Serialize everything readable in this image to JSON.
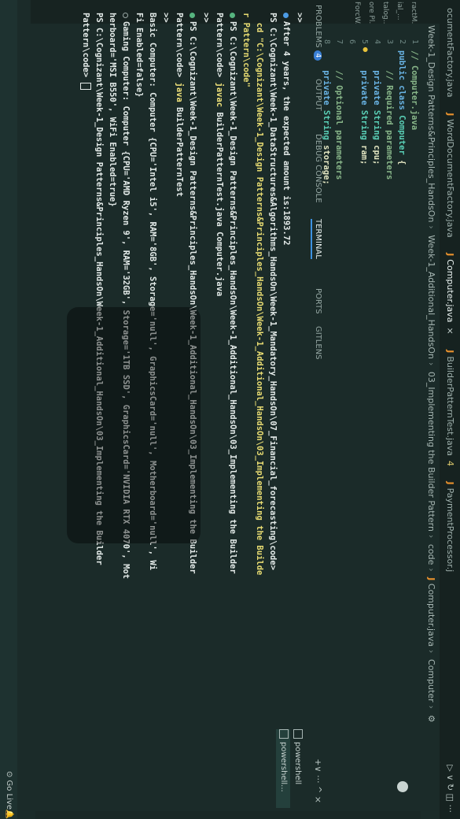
{
  "tabs": [
    {
      "label": "ocumentFactory.java",
      "icon": "",
      "modified": "",
      "active": false,
      "close": ""
    },
    {
      "label": "WordDocumentFactory.java",
      "icon": "J",
      "modified": "",
      "active": false,
      "close": ""
    },
    {
      "label": "Computer.java",
      "icon": "J",
      "modified": "",
      "active": true,
      "close": "×"
    },
    {
      "label": "BuilderPatternTest.java",
      "icon": "J",
      "modified": "4",
      "active": false,
      "close": ""
    },
    {
      "label": "PaymentProcessor.j",
      "icon": "J",
      "modified": "",
      "active": false,
      "close": ""
    }
  ],
  "tab_actions": "▷ ∨ ↻ ◫ ···",
  "breadcrumb": {
    "segments": [
      "Week-1_Design Patterns&Principles_HandsOn",
      "Week-1_Additional_HandsOn",
      "03_Implementing the Builder Pattern",
      "code"
    ],
    "file_icon": "J",
    "file": "Computer.java",
    "symbol": "Computer",
    "symbol_tail": "⚙"
  },
  "sidebar": [
    "ractM...",
    "ial_...",
    "talog...",
    "ore Pl...",
    "ForcW..."
  ],
  "gutter": [
    "1",
    "2",
    "3",
    "4",
    "5",
    "6",
    "7",
    "8"
  ],
  "code": {
    "l1": "// Computer.java",
    "l2_kw": "public class",
    "l2_name": "Computer",
    "l2_brace": "{",
    "l3": "// Required parameters",
    "l4_kw": "private",
    "l4_type": "String",
    "l4_name": "cpu;",
    "l5_kw": "private",
    "l5_type": "String",
    "l5_name": "ram;",
    "l7": "// Optional parameters",
    "l8_kw": "private",
    "l8_type": "String",
    "l8_name": "storage;"
  },
  "panel_tabs": {
    "problems": "PROBLEMS",
    "problems_count": "4",
    "output": "OUTPUT",
    "debug": "DEBUG CONSOLE",
    "terminal": "TERMINAL",
    "ports": "PORTS",
    "gitlens": "GITLENS",
    "actions": "+∨ ··· ^ ×"
  },
  "terminal": {
    "t1": ">>",
    "t2": "After 4 years, the expected amount is:1893.72",
    "t3": "PS C:\\Cognizant\\Week-1_DataStructures&Algorithms_HandsOn\\Week-1_Mandatory_HandsOn\\07_Financial_forecasting\\code>",
    "t4_cmd": "cd",
    "t4_arg": "\"C:\\Cognizant\\Week-1_Design Patterns&Principles_HandsOn\\Week-1_Additional_HandsOn\\03_Implementing the Builde",
    "t5": "r Pattern\\code\"",
    "t6": "PS C:\\Cognizant\\Week-1_Design Patterns&Principles_HandsOn\\Week-1_Additional_HandsOn\\03_Implementing the Builder",
    "t7_prefix": "Pattern\\code>",
    "t7_cmd": "javac",
    "t7_args": "BuilderPatternTest.java Computer.java",
    "t8": ">>",
    "t9": "PS C:\\Cognizant\\Week-1_Design Patterns&Principles_HandsOn\\Week-1_Additional_HandsOn\\03_Implementing the Builder",
    "t10_prefix": "Pattern\\code>",
    "t10_cmd": "java",
    "t10_args": "BuilderPatternTest",
    "t11": ">>",
    "t12": "Basic Computer: Computer {CPU='Intel i5', RAM='8GB', Storage='null', GraphicsCard='null', Motherboard='null', Wi",
    "t13": "Fi Enabled=false}",
    "t14": "Gaming Computer: Computer {CPU='AMD Ryzen 9', RAM='32GB', Storage='1TB SSD', GraphicsCard='NVIDIA RTX 4070', Mot",
    "t15": "herboard='MSI B550', WiFi Enabled=true}",
    "t16": "PS C:\\Cognizant\\Week-1_Design Patterns&Principles_HandsOn\\Week-1_Additional_HandsOn\\03_Implementing the Builder",
    "t17": "Pattern\\code>"
  },
  "shells": [
    "powershell",
    "powershell..."
  ],
  "status": {
    "go_live": "⊙ Go Live",
    "bell": "🔔"
  }
}
